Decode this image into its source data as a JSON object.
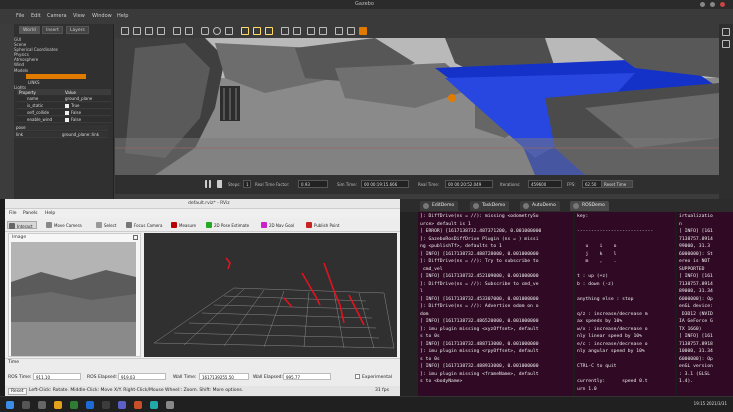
{
  "gazebo": {
    "title": "Gazebo",
    "menu": [
      "File",
      "Edit",
      "Camera",
      "View",
      "Window",
      "Help"
    ],
    "tabs": [
      "World",
      "Insert",
      "Layers"
    ],
    "tree": [
      "GUI",
      "Scene",
      "Spherical Coordinates",
      "Physics",
      "Atmosphere",
      "Wind",
      "Models",
      "Lights"
    ],
    "selected_link": "LINKS",
    "props_header": {
      "property": "Property",
      "value": "Value"
    },
    "props": [
      {
        "k": "name",
        "v": "ground_plane"
      },
      {
        "k": "is_static",
        "v": "True"
      },
      {
        "k": "self_collide",
        "v": "False"
      },
      {
        "k": "enable_wind",
        "v": "False"
      },
      {
        "k": "pose",
        "v": ""
      },
      {
        "k": "link",
        "v": "ground_plane::link"
      }
    ],
    "status": {
      "steps_label": "Steps:",
      "steps_value": "1",
      "rtf_label": "Real Time Factor:",
      "rtf_value": "0.93",
      "sim_label": "Sim Time:",
      "sim_value": "00 00:19:15.666",
      "real_label": "Real Time:",
      "real_value": "00 00:20:52.049",
      "iter_label": "Iterations:",
      "iter_value": "459600",
      "fps_label": "FPS:",
      "fps_value": "62.50",
      "reset_label": "Reset Time"
    }
  },
  "rviz": {
    "title": "default.rviz* - RViz",
    "menu": [
      "File",
      "Panels",
      "Help"
    ],
    "tools": [
      "Interact",
      "Move Camera",
      "Select",
      "Focus Camera",
      "Measure",
      "2D Pose Estimate",
      "2D Nav Goal",
      "Publish Point"
    ],
    "image_panel_title": "Image",
    "time": {
      "panel_title": "Time",
      "ros_time_label": "ROS Time:",
      "ros_time_value": "911.10",
      "ros_elapsed_label": "ROS Elapsed:",
      "ros_elapsed_value": "919.03",
      "wall_time_label": "Wall Time:",
      "wall_time_value": "1617139255.50",
      "wall_elapsed_label": "Wall Elapsed:",
      "wall_elapsed_value": "995.77",
      "experimental": "Experimental"
    },
    "footer": {
      "reset": "Reset",
      "hint": "Left-Click: Rotate. Middle-Click: Move X/Y. Right-Click/Mouse Wheel:: Zoom. Shift: More options.",
      "fps": "31 fps"
    }
  },
  "terminal_tabs": [
    "EditDemo",
    "TaskDemo",
    "AutoDemo",
    "ROSDemo"
  ],
  "term1_lines": [
    "]: DiffDrive(ns = //): missing <odometrySo",
    "urce> default is 1",
    "[ ERROR] [1617138732.487371200, 0.001000000",
    "]: GazeboRosDiffDrive Plugin (ns = ) missi",
    "ng <publishTf>, defaults to 1",
    "[ INFO] [1617138732.488728000, 0.001000000",
    "]: DiffDrive(ns = //): Try to subscribe to",
    " cmd_vel",
    "[ INFO] [1617138732.452109000, 0.001000000",
    "]: DiffDrive(ns = //): Subscribe to cmd_ve",
    "l",
    "[ INFO] [1617138732.453307000, 0.001000000",
    "]: DiffDrive(ns = //): Advertise odom on o",
    "dom",
    "[ INFO] [1617138732.486520000, 0.001000000",
    "]: imu plugin missing <xyzOffset>, default",
    "s to 0s",
    "[ INFO] [1617138732.488713000, 0.001000000",
    "]: imu plugin missing <rpyOffset>, default",
    "s to 0s",
    "[ INFO] [1617138732.488933000, 0.001000000",
    "]: imu plugin missing <frameName>, default",
    "s to <bodyName>"
  ],
  "term2_lines": [
    "key:",
    "",
    "---------------------------",
    "",
    "   u    i    o",
    "   j    k    l",
    "   m    ,    .",
    "",
    "t : up (+z)",
    "b : down (-z)",
    "",
    "anything else : stop",
    "",
    "q/z : increase/decrease m",
    "ax speeds by 10%",
    "w/x : increase/decrease o",
    "nly linear speed by 10%",
    "e/c : increase/decrease o",
    "nly angular speed by 10%",
    "",
    "CTRL-C to quit",
    "",
    "currently:      speed 0.t",
    "urn 1.0"
  ],
  "term3_lines": [
    "irtualizatio",
    "n",
    "[ INFO] [161",
    "7138757.8914",
    "99000, 31.3",
    "6000000]: St",
    "ereo is NOT",
    "SUPPORTED",
    "[ INFO] [161",
    "7138757.8914",
    "89000, 31.34",
    "6000000]: Op",
    "enGL device:",
    " D3D12 (NVID",
    "IA GeForce G",
    "TX 1660)",
    "[ INFO] [161",
    "7138757.8918",
    "10000, 31.34",
    "6000000]: Op",
    "enGL version",
    ": 3.1 (GLSL",
    "1.4)."
  ],
  "taskbar": {
    "time": "19:15",
    "date": "2021/3/31"
  }
}
